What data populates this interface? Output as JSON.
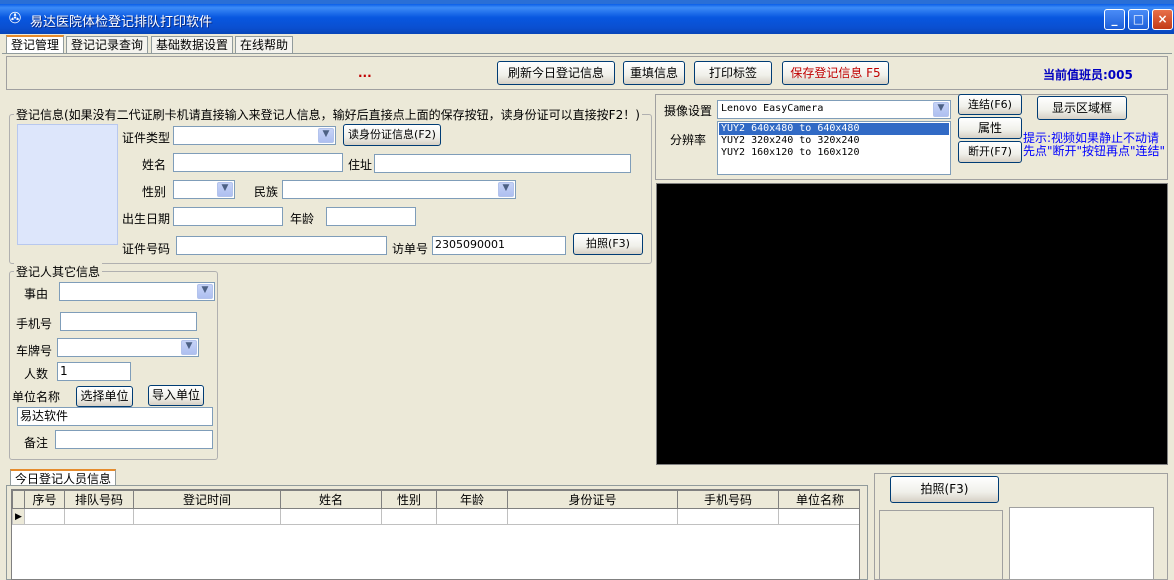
{
  "window": {
    "title": "易达医院体检登记排队打印软件",
    "controls": {
      "minimize": "_",
      "maximize": "□",
      "close": "×"
    }
  },
  "tabs": [
    "登记管理",
    "登记记录查询",
    "基础数据设置",
    "在线帮助"
  ],
  "toolbar": {
    "status_text": "...",
    "refresh": "刷新今日登记信息",
    "reset": "重填信息",
    "print_label": "打印标签",
    "save": "保存登记信息 F5",
    "duty_staff": "当前值班员:005"
  },
  "reg_info": {
    "group_title": "登记信息(如果没有二代证刷卡机请直接输入来登记人信息，输好后直接点上面的保存按钮，读身份证可以直接按F2！)",
    "id_type_label": "证件类型",
    "read_id_button": "读身份证信息(F2)",
    "name_label": "姓名",
    "address_label": "住址",
    "gender_label": "性别",
    "ethnicity_label": "民族",
    "birth_label": "出生日期",
    "age_label": "年龄",
    "id_number_label": "证件号码",
    "visit_no_label": "访单号",
    "visit_no_value": "2305090001",
    "photo_button": "拍照(F3)"
  },
  "other_info": {
    "group_title": "登记人其它信息",
    "reason_label": "事由",
    "phone_label": "手机号",
    "plate_label": "车牌号",
    "count_label": "人数",
    "count_value": "1",
    "company_label": "单位名称",
    "choose_company": "选择单位",
    "import_company": "导入单位",
    "company_value": "易达软件",
    "note_label": "备注"
  },
  "camera": {
    "camera_label": "摄像设置",
    "camera_value": "Lenovo EasyCamera",
    "resolution_label": "分辨率",
    "resolutions": [
      "YUY2 640x480 to 640x480",
      "YUY2 320x240 to 320x240",
      "YUY2 160x120 to 160x120"
    ],
    "connect": "连结(F6)",
    "properties": "属性",
    "disconnect": "断开(F7)",
    "show_region": "显示区域框",
    "hint_line1": "提示:视频如果静止不动请",
    "hint_line2": "先点\"断开\"按钮再点\"连结\""
  },
  "today": {
    "tab": "今日登记人员信息",
    "columns": [
      "序号",
      "排队号码",
      "登记时间",
      "姓名",
      "性别",
      "年龄",
      "身份证号",
      "手机号码",
      "单位名称"
    ],
    "photo_button": "拍照(F3)"
  },
  "colors": {
    "titlebar": "#0a5ee8",
    "save_text": "#c00000",
    "duty_text": "#0000c0",
    "hint_text": "#0000ff",
    "video_bg": "#000000"
  }
}
